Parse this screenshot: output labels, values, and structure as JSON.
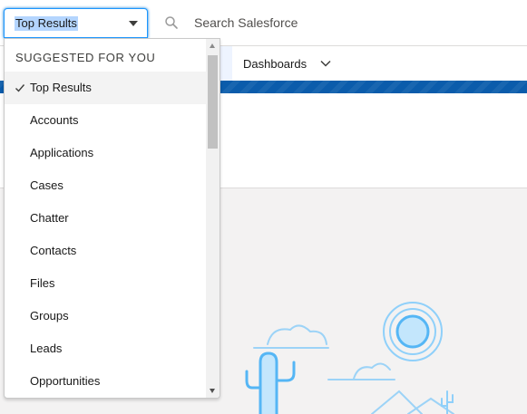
{
  "header": {
    "scope": {
      "selected": "Top Results",
      "caret_icon": "caret-down-icon"
    },
    "search": {
      "placeholder": "Search Salesforce",
      "icon": "search-icon"
    }
  },
  "nav": {
    "items": [
      {
        "label": "Dashboards",
        "icon": "chevron-down-icon"
      }
    ],
    "brand_color": "#0b5cab"
  },
  "dropdown": {
    "header": "SUGGESTED FOR YOU",
    "items": [
      {
        "label": "Top Results",
        "selected": true
      },
      {
        "label": "Accounts",
        "selected": false
      },
      {
        "label": "Applications",
        "selected": false
      },
      {
        "label": "Cases",
        "selected": false
      },
      {
        "label": "Chatter",
        "selected": false
      },
      {
        "label": "Contacts",
        "selected": false
      },
      {
        "label": "Files",
        "selected": false
      },
      {
        "label": "Groups",
        "selected": false
      },
      {
        "label": "Leads",
        "selected": false
      },
      {
        "label": "Opportunities",
        "selected": false
      }
    ]
  },
  "colors": {
    "accent": "#1b96ff",
    "illustration": "#55b6f5"
  }
}
